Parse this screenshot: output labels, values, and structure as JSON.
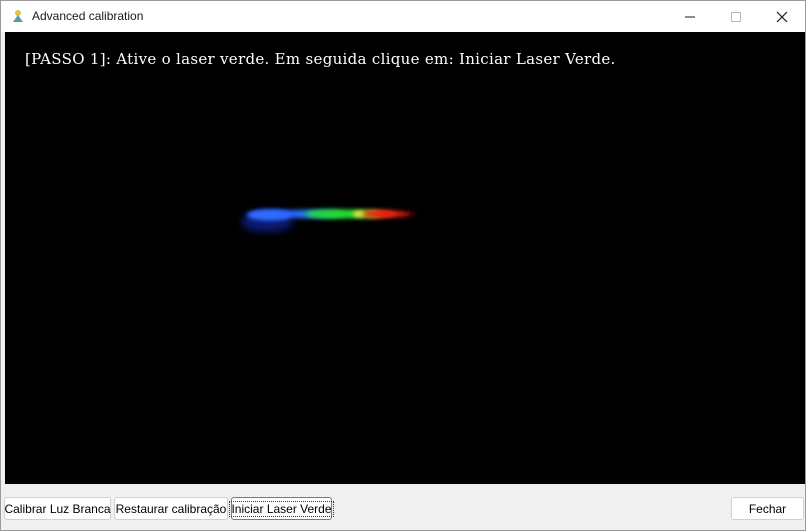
{
  "window": {
    "title": "Advanced calibration"
  },
  "canvas": {
    "instruction": "[PASSO 1]: Ative o laser verde. Em seguida clique em: Iniciar Laser Verde."
  },
  "buttons": {
    "calibrate_white": "Calibrar Luz Branca",
    "restore_calibration": "Restaurar calibração",
    "start_green_laser": "Iniciar Laser Verde",
    "close": "Fechar"
  },
  "icons": {
    "app": "app-icon",
    "minimize": "minimize-icon",
    "maximize": "maximize-icon",
    "close": "close-icon"
  },
  "colors": {
    "canvas_bg": "#000000",
    "instruction_text": "#ffffff",
    "spectrum_blue": "#2a5cff",
    "spectrum_green": "#22dd33",
    "spectrum_red": "#ee2211"
  }
}
